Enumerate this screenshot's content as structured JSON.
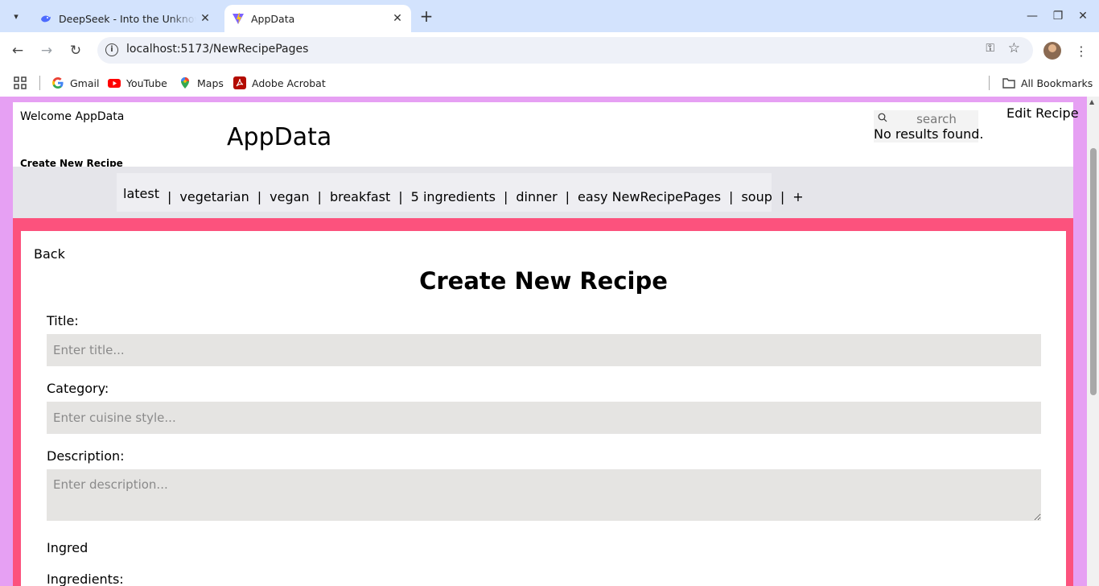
{
  "browser": {
    "tabs": [
      {
        "title": "DeepSeek - Into the Unknown",
        "active": false
      },
      {
        "title": "AppData",
        "active": true
      }
    ],
    "url": "localhost:5173/NewRecipePages",
    "bookmarks": [
      "Gmail",
      "YouTube",
      "Maps",
      "Adobe Acrobat"
    ],
    "all_bookmarks": "All Bookmarks"
  },
  "header": {
    "welcome": "Welcome AppData",
    "brand": "AppData",
    "create_link": "Create New Recipe",
    "search_placeholder": "search",
    "search_status": "No results found.",
    "edit_link": "Edit Recipe"
  },
  "categories": [
    "latest",
    "vegetarian",
    "vegan",
    "breakfast",
    "5 ingredients",
    "dinner",
    "easy NewRecipePages",
    "soup",
    "+"
  ],
  "form": {
    "back": "Back",
    "heading": "Create New Recipe",
    "title_label": "Title:",
    "title_placeholder": "Enter title...",
    "category_label": "Category:",
    "category_placeholder": "Enter cuisine style...",
    "description_label": "Description:",
    "description_placeholder": "Enter description...",
    "ingred_text": "Ingred",
    "ingredients_label": "Ingredients:"
  },
  "colors": {
    "page_background": "#e6a0f3",
    "accent_pink": "#fc527d",
    "tabbar": "#d3e3fd"
  }
}
